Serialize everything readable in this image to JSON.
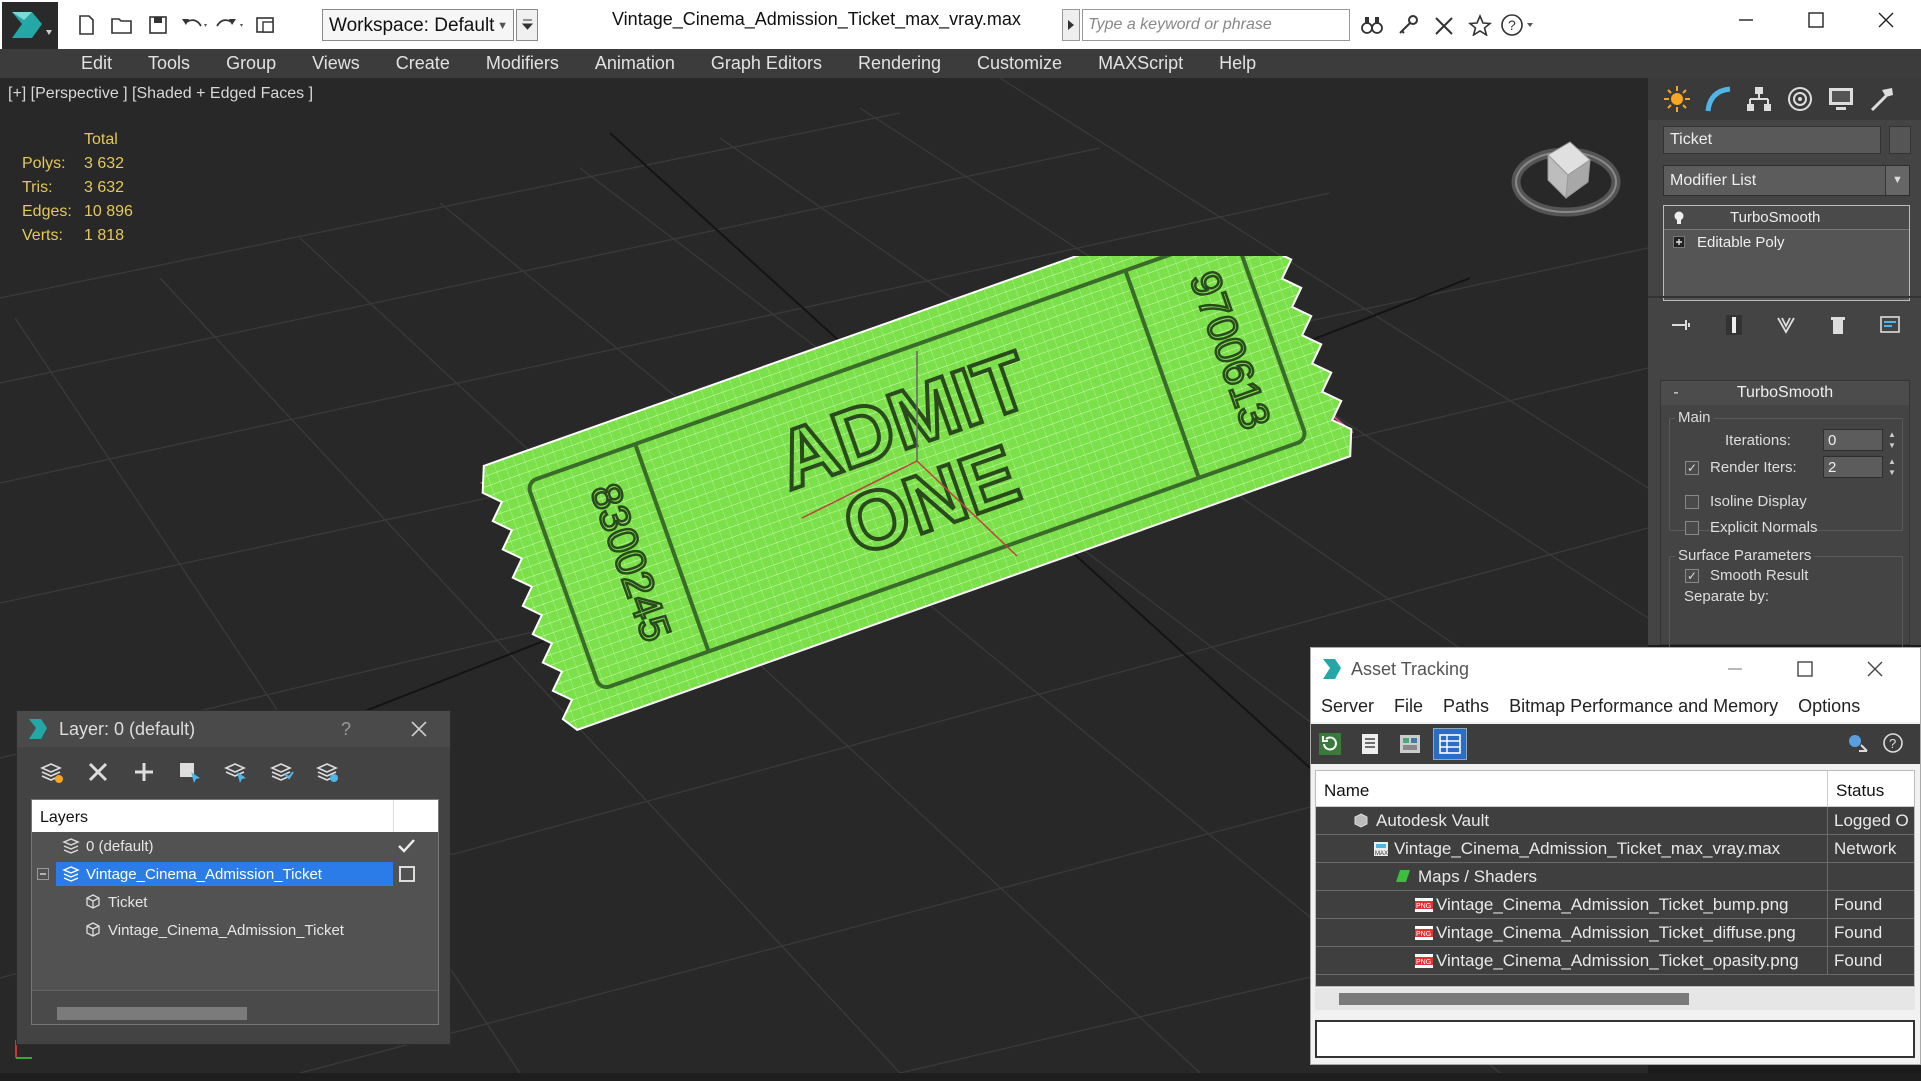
{
  "titlebar": {
    "workspace_label": "Workspace: Default",
    "document_title": "Vintage_Cinema_Admission_Ticket_max_vray.max",
    "search_placeholder": "Type a keyword or phrase"
  },
  "menubar": {
    "items": [
      "Edit",
      "Tools",
      "Group",
      "Views",
      "Create",
      "Modifiers",
      "Animation",
      "Graph Editors",
      "Rendering",
      "Customize",
      "MAXScript",
      "Help"
    ]
  },
  "viewport": {
    "label": "[+] [Perspective ] [Shaded + Edged Faces ]",
    "stats": {
      "header": "Total",
      "rows": [
        {
          "label": "Polys:",
          "value": "3 632"
        },
        {
          "label": "Tris:",
          "value": "3 632"
        },
        {
          "label": "Edges:",
          "value": "10 896"
        },
        {
          "label": "Verts:",
          "value": "1 818"
        }
      ]
    },
    "ticket": {
      "line1": "ADMIT",
      "line2": "ONE",
      "serial_left": "8300245",
      "serial_right": "9700613",
      "color": "#7be04a"
    }
  },
  "command_panel": {
    "object_name": "Ticket",
    "modifier_list_label": "Modifier List",
    "stack": [
      "TurboSmooth",
      "Editable Poly"
    ],
    "turbosmooth": {
      "title": "TurboSmooth",
      "main_group": "Main",
      "iterations_label": "Iterations:",
      "iterations_value": "0",
      "render_iters_label": "Render Iters:",
      "render_iters_value": "2",
      "render_iters_checked": true,
      "isoline_label": "Isoline Display",
      "isoline_checked": false,
      "explicit_normals_label": "Explicit Normals",
      "explicit_normals_checked": false,
      "surface_group": "Surface Parameters",
      "smooth_result_label": "Smooth Result",
      "smooth_result_checked": true,
      "separate_by_label": "Separate by:"
    }
  },
  "layer_window": {
    "title": "Layer: 0 (default)",
    "help": "?",
    "column": "Layers",
    "rows": [
      {
        "label": "0 (default)",
        "type": "layer",
        "selected": false,
        "indent": 0
      },
      {
        "label": "Vintage_Cinema_Admission_Ticket",
        "type": "layer",
        "selected": true,
        "indent": 0
      },
      {
        "label": "Ticket",
        "type": "object",
        "selected": false,
        "indent": 1
      },
      {
        "label": "Vintage_Cinema_Admission_Ticket",
        "type": "object",
        "selected": false,
        "indent": 1
      }
    ]
  },
  "asset_tracking": {
    "title": "Asset Tracking",
    "menu": [
      "Server",
      "File",
      "Paths",
      "Bitmap Performance and Memory",
      "Options"
    ],
    "columns": {
      "name": "Name",
      "status": "Status"
    },
    "rows": [
      {
        "name": "Autodesk Vault",
        "status": "Logged O",
        "icon": "vault-icon",
        "indent": 1
      },
      {
        "name": "Vintage_Cinema_Admission_Ticket_max_vray.max",
        "status": "Network",
        "icon": "max-file-icon",
        "indent": 2
      },
      {
        "name": "Maps / Shaders",
        "status": "",
        "icon": "maps-icon",
        "indent": 3
      },
      {
        "name": "Vintage_Cinema_Admission_Ticket_bump.png",
        "status": "Found",
        "icon": "png-icon",
        "indent": 4
      },
      {
        "name": "Vintage_Cinema_Admission_Ticket_diffuse.png",
        "status": "Found",
        "icon": "png-icon",
        "indent": 4
      },
      {
        "name": "Vintage_Cinema_Admission_Ticket_opasity.png",
        "status": "Found",
        "icon": "png-icon",
        "indent": 4
      }
    ]
  }
}
